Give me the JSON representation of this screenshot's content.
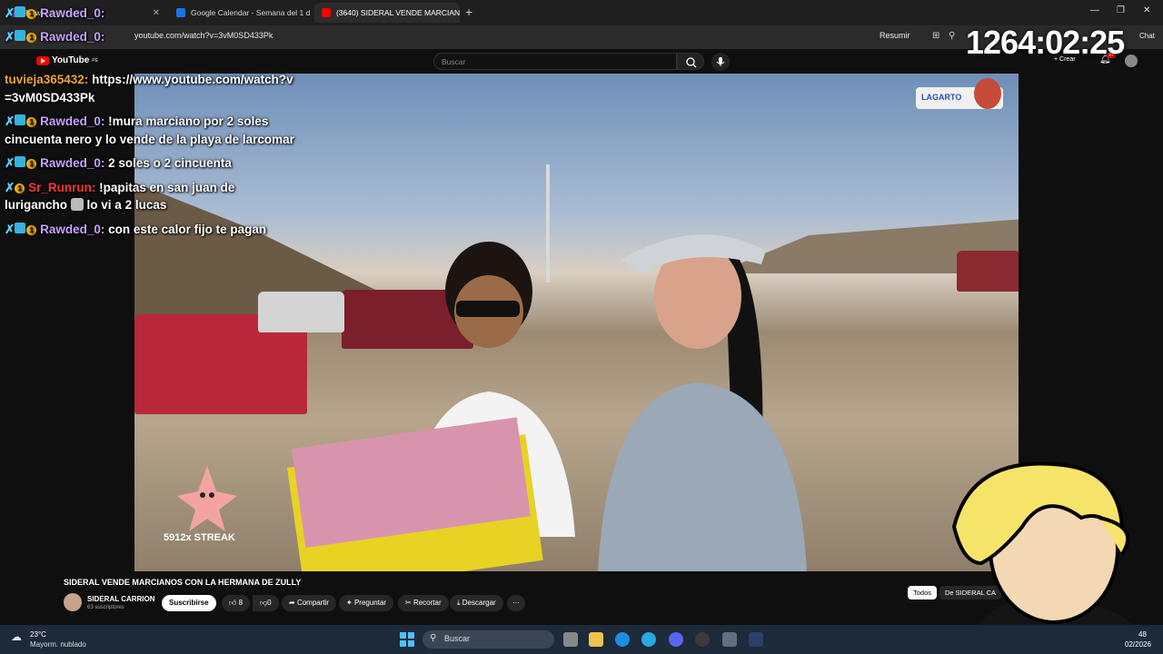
{
  "browser": {
    "tabs": [
      {
        "label": "Rawded_0: rush (",
        "active": false
      },
      {
        "label": "Google Calendar - Semana del 1 d",
        "active": false
      },
      {
        "label": "(3640) SIDERAL VENDE MARCIAN",
        "active": true
      }
    ],
    "new_tab": "+",
    "url": "youtube.com/watch?v=3vM0SD433Pk",
    "resumir": "Resumir",
    "chat_label": "Chat"
  },
  "youtube": {
    "logo": "YouTube",
    "region": "PE",
    "search_placeholder": "Buscar",
    "crear": "Crear",
    "notif_count": "9+"
  },
  "overlay": {
    "timer": "1264:02:25",
    "lagarto": "LAGARTO",
    "streak": "5912x STREAK",
    "top_name": "Rawded_0:"
  },
  "chat": [
    {
      "user": "tuvieja365432:",
      "text": "https://www.youtube.com/watch?v=3vM0SD433Pk",
      "color": "org"
    },
    {
      "user": "Rawded_0:",
      "text": "!mura marciano por 2 soles cincuenta nero y lo vende de la playa de larcomar",
      "color": "purple"
    },
    {
      "user": "Rawded_0:",
      "text": "2 soles o 2 cincuenta",
      "color": "purple"
    },
    {
      "user": "Sr_Runrun:",
      "text": "!papitas en san juan de lurigancho",
      "text2": "lo vi a 2 lucas",
      "color": "red"
    },
    {
      "user": "Rawded_0:",
      "text": "con este calor fijo te pagan",
      "color": "purple"
    }
  ],
  "video": {
    "title": "SIDERAL VENDE MARCIANOS CON LA HERMANA DE ZULLY",
    "channel": "SIDERAL CARRION",
    "subs": "63 suscriptores",
    "subscribe": "Suscribirse",
    "likes": "8",
    "dislikes": "0",
    "share": "Compartir",
    "ask": "Preguntar",
    "clip": "Recortar",
    "download": "Descargar",
    "more": "···",
    "todos": "Todos",
    "de_sideral": "De SIDERAL CA"
  },
  "taskbar": {
    "temp": "23°C",
    "weather": "Mayorm. nublado",
    "search": "Buscar",
    "time": "48",
    "date": "02/2026"
  },
  "colors": {
    "yt_red": "#ff0000",
    "chat_purple": "#c7a1ff",
    "chat_orange": "#f0a838",
    "chat_red": "#ff3535"
  }
}
